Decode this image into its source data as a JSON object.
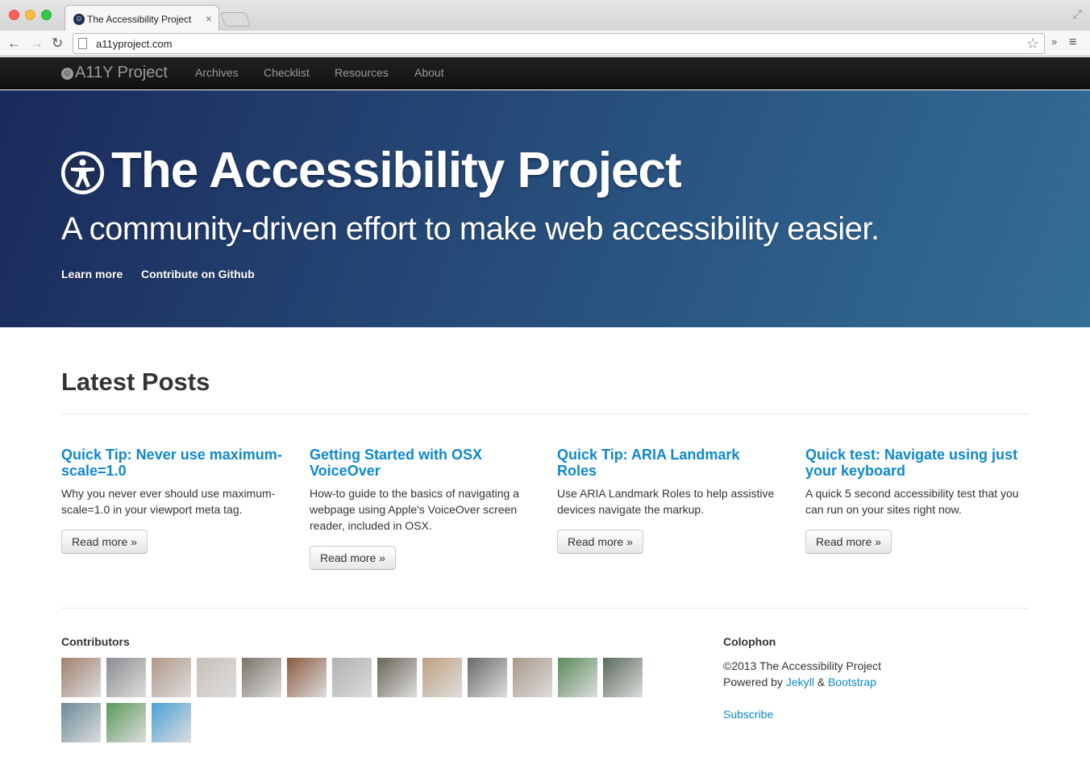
{
  "browser": {
    "tab_title": "The Accessibility Project",
    "tab_close": "×",
    "url": "a11yproject.com",
    "back": "←",
    "forward": "→",
    "reload": "↻",
    "star": "☆",
    "extensions": "»",
    "menu": "≡",
    "fullscreen": "⤢"
  },
  "nav": {
    "brand": "A11Y Project",
    "items": [
      "Archives",
      "Checklist",
      "Resources",
      "About"
    ]
  },
  "hero": {
    "title": "The Accessibility Project",
    "subtitle": "A community-driven effort to make web accessibility easier.",
    "links": [
      "Learn more",
      "Contribute on Github"
    ]
  },
  "latest": {
    "heading": "Latest Posts",
    "posts": [
      {
        "title": "Quick Tip: Never use maximum-scale=1.0",
        "desc": "Why you never ever should use maximum-scale=1.0 in your viewport meta tag.",
        "button": "Read more »"
      },
      {
        "title": "Getting Started with OSX VoiceOver",
        "desc": "How-to guide to the basics of navigating a webpage using Apple's VoiceOver screen reader, included in OSX.",
        "button": "Read more »"
      },
      {
        "title": "Quick Tip: ARIA Landmark Roles",
        "desc": "Use ARIA Landmark Roles to help assistive devices navigate the markup.",
        "button": "Read more »"
      },
      {
        "title": "Quick test: Navigate using just your keyboard",
        "desc": "A quick 5 second accessibility test that you can run on your sites right now.",
        "button": "Read more »"
      }
    ]
  },
  "footer": {
    "contributors_heading": "Contributors",
    "avatar_colors": [
      "#a08070",
      "#8a8d90",
      "#b09888",
      "#c8c0b8",
      "#7a7468",
      "#8a5a40",
      "#b0b0b0",
      "#6a6458",
      "#c0a080",
      "#6a6a6a",
      "#a89888",
      "#5a8a5a",
      "#5a6a5a",
      "#6a8a98",
      "#5a9a5a",
      "#4aa0d8"
    ],
    "colophon_heading": "Colophon",
    "copyright": "©2013 The Accessibility Project",
    "powered_prefix": "Powered by ",
    "powered_jekyll": "Jekyll",
    "powered_amp": " & ",
    "powered_bootstrap": "Bootstrap",
    "subscribe": "Subscribe"
  }
}
